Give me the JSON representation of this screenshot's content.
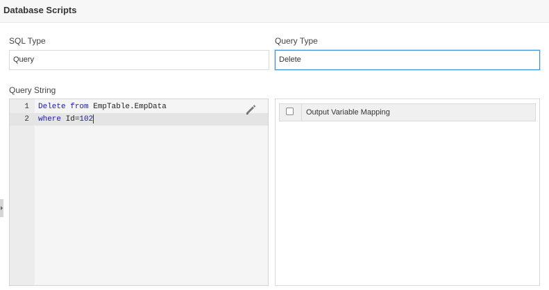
{
  "header": {
    "title": "Database Scripts"
  },
  "sql_type": {
    "label": "SQL Type",
    "value": "Query"
  },
  "query_type": {
    "label": "Query Type",
    "value": "Delete"
  },
  "query_string": {
    "label": "Query String",
    "lines": [
      {
        "number": "1",
        "tokens": [
          {
            "text": "Delete",
            "kind": "keyword"
          },
          {
            "text": " "
          },
          {
            "text": "from",
            "kind": "keyword"
          },
          {
            "text": " EmpTable.EmpData"
          }
        ]
      },
      {
        "number": "2",
        "tokens": [
          {
            "text": "where",
            "kind": "keyword"
          },
          {
            "text": " Id="
          },
          {
            "text": "102",
            "kind": "number"
          }
        ]
      }
    ],
    "active_line": 2,
    "edit_icon": "pencil-icon"
  },
  "output_mapping": {
    "column_header": "Output Variable Mapping",
    "checked": false
  },
  "colors": {
    "keyword": "#1a1aa6",
    "focus_border": "#3d8fd9"
  }
}
